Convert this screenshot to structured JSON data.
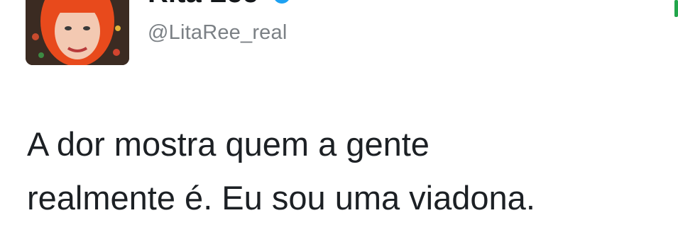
{
  "tweet": {
    "author": {
      "display_name": "Rita Lee",
      "handle": "@LitaRee_real",
      "verified": true,
      "avatar_icon": "profile-photo-red-hair",
      "verified_icon": "verified-badge-icon"
    },
    "text_lines": [
      "A dor mostra quem a gente",
      "realmente é. Eu sou uma viadona."
    ]
  },
  "colors": {
    "verified_blue": "#1da1f2",
    "handle_gray": "#7b8085",
    "text_dark": "#1c2024",
    "indicator_green": "#22a64b"
  }
}
